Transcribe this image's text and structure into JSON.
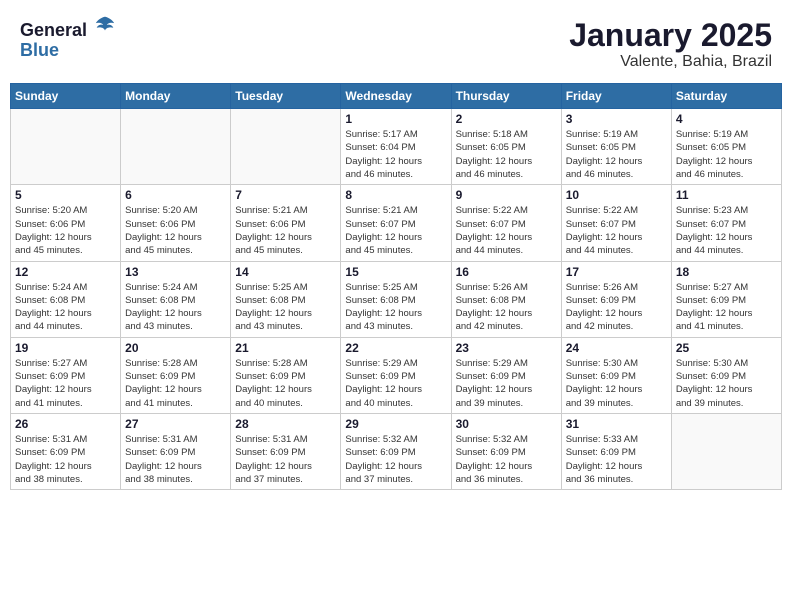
{
  "logo": {
    "general": "General",
    "blue": "Blue"
  },
  "title": {
    "month_year": "January 2025",
    "location": "Valente, Bahia, Brazil"
  },
  "headers": [
    "Sunday",
    "Monday",
    "Tuesday",
    "Wednesday",
    "Thursday",
    "Friday",
    "Saturday"
  ],
  "weeks": [
    [
      {
        "day": "",
        "info": ""
      },
      {
        "day": "",
        "info": ""
      },
      {
        "day": "",
        "info": ""
      },
      {
        "day": "1",
        "info": "Sunrise: 5:17 AM\nSunset: 6:04 PM\nDaylight: 12 hours\nand 46 minutes."
      },
      {
        "day": "2",
        "info": "Sunrise: 5:18 AM\nSunset: 6:05 PM\nDaylight: 12 hours\nand 46 minutes."
      },
      {
        "day": "3",
        "info": "Sunrise: 5:19 AM\nSunset: 6:05 PM\nDaylight: 12 hours\nand 46 minutes."
      },
      {
        "day": "4",
        "info": "Sunrise: 5:19 AM\nSunset: 6:05 PM\nDaylight: 12 hours\nand 46 minutes."
      }
    ],
    [
      {
        "day": "5",
        "info": "Sunrise: 5:20 AM\nSunset: 6:06 PM\nDaylight: 12 hours\nand 45 minutes."
      },
      {
        "day": "6",
        "info": "Sunrise: 5:20 AM\nSunset: 6:06 PM\nDaylight: 12 hours\nand 45 minutes."
      },
      {
        "day": "7",
        "info": "Sunrise: 5:21 AM\nSunset: 6:06 PM\nDaylight: 12 hours\nand 45 minutes."
      },
      {
        "day": "8",
        "info": "Sunrise: 5:21 AM\nSunset: 6:07 PM\nDaylight: 12 hours\nand 45 minutes."
      },
      {
        "day": "9",
        "info": "Sunrise: 5:22 AM\nSunset: 6:07 PM\nDaylight: 12 hours\nand 44 minutes."
      },
      {
        "day": "10",
        "info": "Sunrise: 5:22 AM\nSunset: 6:07 PM\nDaylight: 12 hours\nand 44 minutes."
      },
      {
        "day": "11",
        "info": "Sunrise: 5:23 AM\nSunset: 6:07 PM\nDaylight: 12 hours\nand 44 minutes."
      }
    ],
    [
      {
        "day": "12",
        "info": "Sunrise: 5:24 AM\nSunset: 6:08 PM\nDaylight: 12 hours\nand 44 minutes."
      },
      {
        "day": "13",
        "info": "Sunrise: 5:24 AM\nSunset: 6:08 PM\nDaylight: 12 hours\nand 43 minutes."
      },
      {
        "day": "14",
        "info": "Sunrise: 5:25 AM\nSunset: 6:08 PM\nDaylight: 12 hours\nand 43 minutes."
      },
      {
        "day": "15",
        "info": "Sunrise: 5:25 AM\nSunset: 6:08 PM\nDaylight: 12 hours\nand 43 minutes."
      },
      {
        "day": "16",
        "info": "Sunrise: 5:26 AM\nSunset: 6:08 PM\nDaylight: 12 hours\nand 42 minutes."
      },
      {
        "day": "17",
        "info": "Sunrise: 5:26 AM\nSunset: 6:09 PM\nDaylight: 12 hours\nand 42 minutes."
      },
      {
        "day": "18",
        "info": "Sunrise: 5:27 AM\nSunset: 6:09 PM\nDaylight: 12 hours\nand 41 minutes."
      }
    ],
    [
      {
        "day": "19",
        "info": "Sunrise: 5:27 AM\nSunset: 6:09 PM\nDaylight: 12 hours\nand 41 minutes."
      },
      {
        "day": "20",
        "info": "Sunrise: 5:28 AM\nSunset: 6:09 PM\nDaylight: 12 hours\nand 41 minutes."
      },
      {
        "day": "21",
        "info": "Sunrise: 5:28 AM\nSunset: 6:09 PM\nDaylight: 12 hours\nand 40 minutes."
      },
      {
        "day": "22",
        "info": "Sunrise: 5:29 AM\nSunset: 6:09 PM\nDaylight: 12 hours\nand 40 minutes."
      },
      {
        "day": "23",
        "info": "Sunrise: 5:29 AM\nSunset: 6:09 PM\nDaylight: 12 hours\nand 39 minutes."
      },
      {
        "day": "24",
        "info": "Sunrise: 5:30 AM\nSunset: 6:09 PM\nDaylight: 12 hours\nand 39 minutes."
      },
      {
        "day": "25",
        "info": "Sunrise: 5:30 AM\nSunset: 6:09 PM\nDaylight: 12 hours\nand 39 minutes."
      }
    ],
    [
      {
        "day": "26",
        "info": "Sunrise: 5:31 AM\nSunset: 6:09 PM\nDaylight: 12 hours\nand 38 minutes."
      },
      {
        "day": "27",
        "info": "Sunrise: 5:31 AM\nSunset: 6:09 PM\nDaylight: 12 hours\nand 38 minutes."
      },
      {
        "day": "28",
        "info": "Sunrise: 5:31 AM\nSunset: 6:09 PM\nDaylight: 12 hours\nand 37 minutes."
      },
      {
        "day": "29",
        "info": "Sunrise: 5:32 AM\nSunset: 6:09 PM\nDaylight: 12 hours\nand 37 minutes."
      },
      {
        "day": "30",
        "info": "Sunrise: 5:32 AM\nSunset: 6:09 PM\nDaylight: 12 hours\nand 36 minutes."
      },
      {
        "day": "31",
        "info": "Sunrise: 5:33 AM\nSunset: 6:09 PM\nDaylight: 12 hours\nand 36 minutes."
      },
      {
        "day": "",
        "info": ""
      }
    ]
  ]
}
